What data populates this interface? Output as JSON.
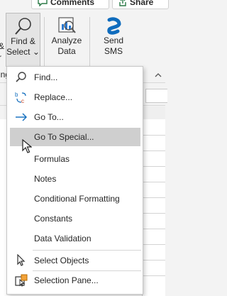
{
  "ribbon": {
    "comments_label": "Comments",
    "share_label": "Share",
    "find_select_line1": "Find &",
    "find_select_line2": "Select",
    "analyze_line1": "Analyze",
    "analyze_line2": "Data",
    "sms_line1": "Send",
    "sms_line2": "SMS",
    "left_edge_top": "&",
    "left_edge_bottom": "r",
    "left_edge_mid": "ing"
  },
  "menu": {
    "items": [
      {
        "label": "Find...",
        "icon": "search-icon"
      },
      {
        "label": "Replace...",
        "icon": "replace-icon"
      },
      {
        "label": "Go To...",
        "icon": "arrow-right-icon"
      },
      {
        "label": "Go To Special...",
        "icon": ""
      },
      {
        "label": "Formulas",
        "icon": ""
      },
      {
        "label": "Notes",
        "icon": ""
      },
      {
        "label": "Conditional Formatting",
        "icon": ""
      },
      {
        "label": "Constants",
        "icon": ""
      },
      {
        "label": "Data Validation",
        "icon": ""
      },
      {
        "label": "Select Objects",
        "icon": "pointer-icon"
      },
      {
        "label": "Selection Pane...",
        "icon": "selection-pane-icon"
      }
    ],
    "highlighted_index": 3
  },
  "colors": {
    "accent_green": "#2b7a47",
    "sms_blue": "#0f6cbd",
    "highlight": "#cfcfcf"
  }
}
